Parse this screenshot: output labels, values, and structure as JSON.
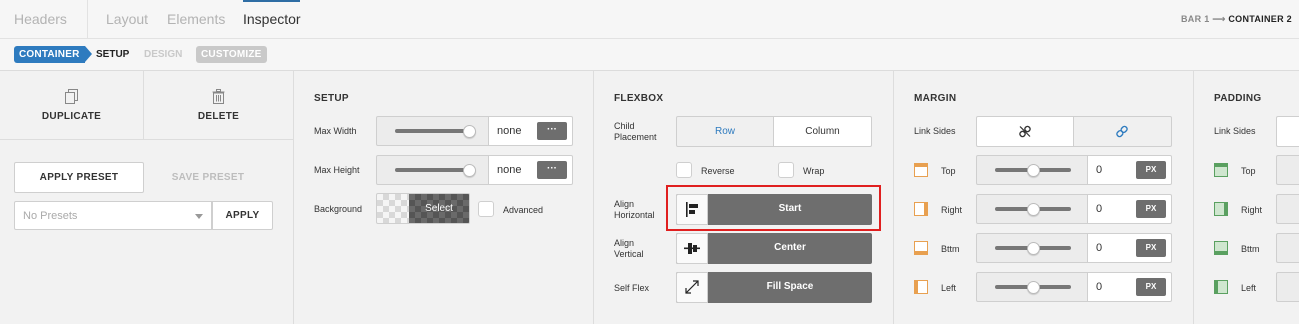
{
  "topnav": {
    "tabs": [
      {
        "label": "Headers",
        "active": false
      },
      {
        "label": "Layout",
        "active": false
      },
      {
        "label": "Elements",
        "active": false
      },
      {
        "label": "Inspector",
        "active": true
      }
    ],
    "breadcrumb": {
      "parent": "BAR 1",
      "separator": "⟶",
      "current": "CONTAINER 2"
    }
  },
  "subnav": {
    "container_label": "CONTAINER",
    "steps": [
      "SETUP",
      "DESIGN",
      "CUSTOMIZE"
    ]
  },
  "left": {
    "duplicate_label": "DUPLICATE",
    "delete_label": "DELETE",
    "apply_preset_label": "APPLY PRESET",
    "save_preset_label": "SAVE PRESET",
    "preset_select_value": "No Presets",
    "apply_label": "APPLY"
  },
  "setup": {
    "title": "SETUP",
    "max_width": {
      "label": "Max Width",
      "value": "none",
      "more": "···",
      "slider_level": 1.0
    },
    "max_height": {
      "label": "Max Height",
      "value": "none",
      "more": "···",
      "slider_level": 1.0
    },
    "background": {
      "label": "Background",
      "select_label": "Select",
      "advanced_label": "Advanced"
    }
  },
  "flexbox": {
    "title": "FLEXBOX",
    "child_placement_label": "Child Placement",
    "row_label": "Row",
    "column_label": "Column",
    "selected": "Row",
    "reverse_label": "Reverse",
    "wrap_label": "Wrap",
    "align_horizontal_label": "Align Horizontal",
    "align_horizontal_value": "Start",
    "align_vertical_label": "Align Vertical",
    "align_vertical_value": "Center",
    "self_flex_label": "Self Flex",
    "self_flex_value": "Fill Space"
  },
  "margin": {
    "title": "MARGIN",
    "link_sides_label": "Link Sides",
    "sides": [
      {
        "label": "Top",
        "value": "0",
        "unit": "PX"
      },
      {
        "label": "Right",
        "value": "0",
        "unit": "PX"
      },
      {
        "label": "Bttm",
        "value": "0",
        "unit": "PX"
      },
      {
        "label": "Left",
        "value": "0",
        "unit": "PX"
      }
    ],
    "slider_level": 0.5
  },
  "padding": {
    "title": "PADDING",
    "link_sides_label": "Link Sides",
    "sides": [
      {
        "label": "Top"
      },
      {
        "label": "Right"
      },
      {
        "label": "Bttm"
      },
      {
        "label": "Left"
      }
    ]
  },
  "colors": {
    "accent": "#2e7bbf",
    "dark_button": "#6e6e6e",
    "highlight": "#e01f1f",
    "margin_icon": "#e8a050",
    "padding_icon": "#5aa060"
  }
}
